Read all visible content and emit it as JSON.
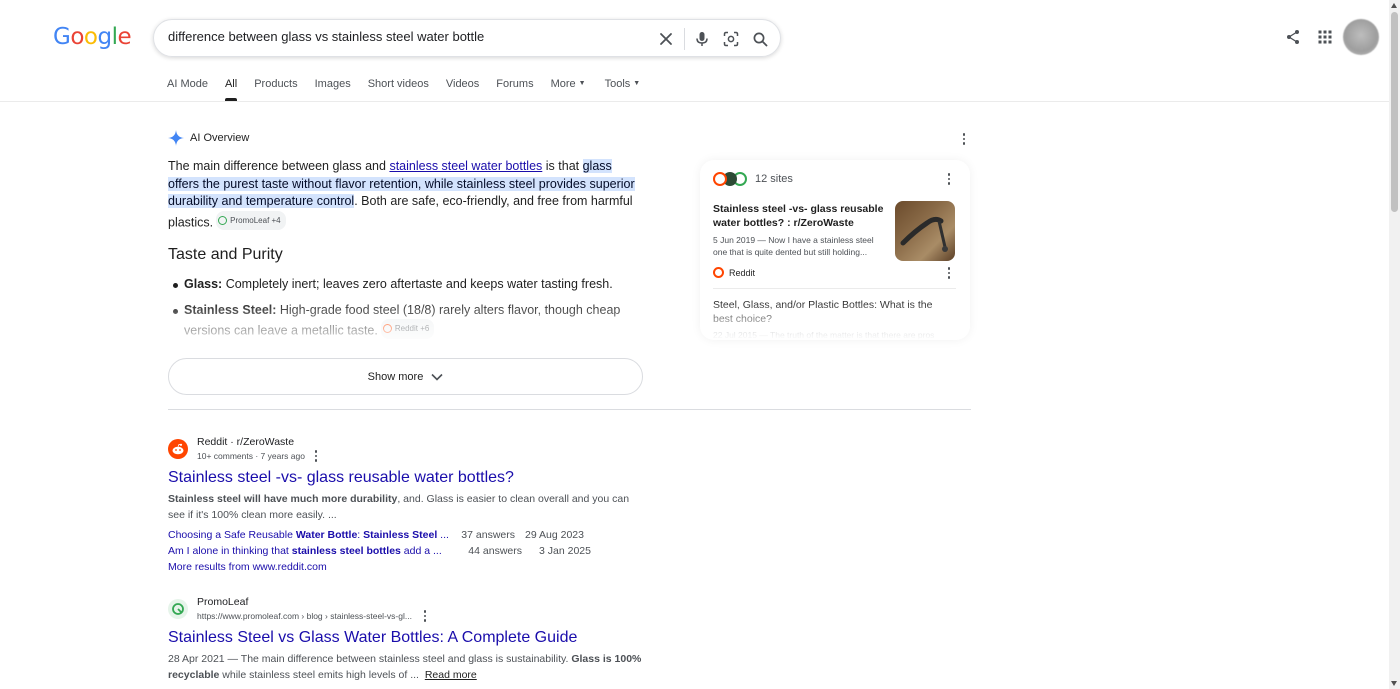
{
  "logo": {
    "letters": [
      "G",
      "o",
      "o",
      "g",
      "l",
      "e"
    ]
  },
  "search": {
    "query": "difference between glass vs stainless steel water bottle"
  },
  "tabs": [
    {
      "label": "AI Mode"
    },
    {
      "label": "All"
    },
    {
      "label": "Products"
    },
    {
      "label": "Images"
    },
    {
      "label": "Short videos"
    },
    {
      "label": "Videos"
    },
    {
      "label": "Forums"
    },
    {
      "label": "More"
    },
    {
      "label": "Tools"
    }
  ],
  "ai_overview": {
    "label": "AI Overview",
    "intro_1": "The main difference between glass and ",
    "intro_link": "stainless steel water bottles",
    "intro_2": " is that ",
    "intro_highlight": "glass offers the purest taste without flavor retention, while stainless steel provides superior durability and temperature control",
    "intro_3": ". Both are safe, eco-friendly, and free from harmful plastics.",
    "intro_chip": "PromoLeaf +4",
    "heading": "Taste and Purity",
    "bullets": [
      {
        "term": "Glass:",
        "text": " Completely inert; leaves zero aftertaste and keeps water tasting fresh."
      },
      {
        "term": "Stainless Steel:",
        "text": " High-grade food steel (18/8) rarely alters flavor, though cheap versions can leave a metallic taste.",
        "chip": "Reddit +6"
      }
    ],
    "show_more": "Show more"
  },
  "sources_panel": {
    "count_label": "12 sites",
    "card1": {
      "title": "Stainless steel -vs- glass reusable water bottles? : r/ZeroWaste",
      "snippet": "5 Jun 2019 — Now I have a stainless steel one that is quite dented but still holding...",
      "source": "Reddit"
    },
    "card2": {
      "title": "Steel, Glass, and/or Plastic Bottles: What is the best choice?",
      "snippet": "22 Jul 2015 — The truth of the matter is that there are pros"
    }
  },
  "results": [
    {
      "site_name": "Reddit · r/ZeroWaste",
      "meta": "10+ comments · 7 years ago",
      "title": "Stainless steel -vs- glass reusable water bottles?",
      "snippet_b1": "Stainless steel will have much more durability",
      "snippet_1": ", and. Glass is easier to clean overall and you can see if it's 100% clean more easily. ...",
      "sublinks": [
        {
          "p1": "Choosing a Safe Reusable ",
          "b1": "Water Bottle",
          "p2": ": ",
          "b2": "Stainless Steel",
          "p3": " ...",
          "answers": "37 answers",
          "date": "29 Aug 2023"
        },
        {
          "p1": "Am I alone in thinking that ",
          "b1": "stainless steel bottles",
          "p2": " add a ...",
          "b2": "",
          "p3": "",
          "answers": "44 answers",
          "date": "3 Jan 2025"
        }
      ],
      "more_results": "More results from www.reddit.com"
    },
    {
      "site_name": "PromoLeaf",
      "meta": "https://www.promoleaf.com › blog › stainless-steel-vs-gl...",
      "title": "Stainless Steel vs Glass Water Bottles: A Complete Guide",
      "snippet_1": "28 Apr 2021 — The main difference between stainless steel and glass is sustainability. ",
      "snippet_b1": "Glass is 100% recyclable",
      "snippet_2": " while stainless steel emits high levels of ...",
      "read_more": "Read more"
    }
  ],
  "colors": {
    "link": "#1a0dab",
    "highlight": "#d3e3fd",
    "reddit": "#ff4500",
    "promoleaf": "#34a853"
  }
}
